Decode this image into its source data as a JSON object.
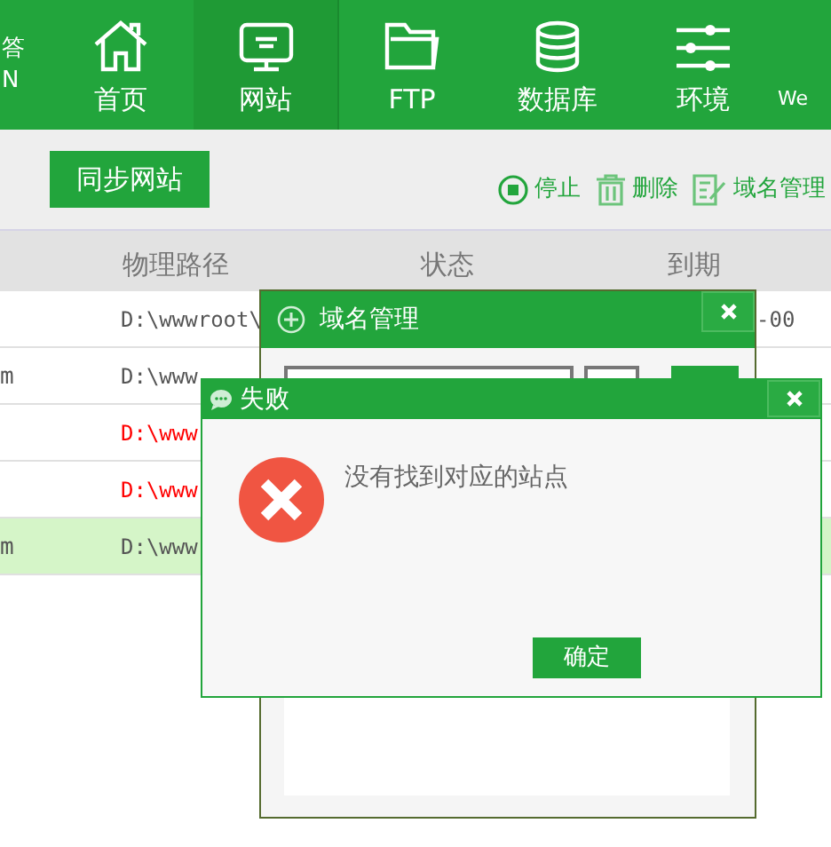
{
  "logo": [
    "答",
    "N"
  ],
  "nav": [
    {
      "label": "首页",
      "selected": false
    },
    {
      "label": "网站",
      "selected": true
    },
    {
      "label": "FTP",
      "selected": false
    },
    {
      "label": "数据库",
      "selected": false
    },
    {
      "label": "环境",
      "selected": false
    },
    {
      "label": "We",
      "selected": false
    }
  ],
  "toolbar": {
    "sync_button": "同步网站",
    "actions": [
      {
        "label": "停止"
      },
      {
        "label": "删除"
      },
      {
        "label": "域名管理"
      }
    ]
  },
  "table": {
    "columns": [
      "物理路径",
      "状态",
      "到期"
    ],
    "rows": [
      {
        "name": "",
        "path": "D:\\wwwroot\\",
        "color": "#555555",
        "expiry": "-00",
        "selected": false
      },
      {
        "name": "m",
        "path": "D:\\www",
        "color": "#555555",
        "expiry": "",
        "selected": false
      },
      {
        "name": "",
        "path": "D:\\www",
        "color": "#ff0000",
        "expiry": "",
        "selected": false
      },
      {
        "name": "",
        "path": "D:\\www",
        "color": "#ff0000",
        "expiry": "",
        "selected": false
      },
      {
        "name": "m",
        "path": "D:\\www",
        "color": "#555555",
        "expiry": "",
        "selected": true
      }
    ]
  },
  "domain_dialog": {
    "title": "域名管理"
  },
  "error_dialog": {
    "title": "失败",
    "message": "没有找到对应的站点",
    "ok_button": "确定"
  }
}
